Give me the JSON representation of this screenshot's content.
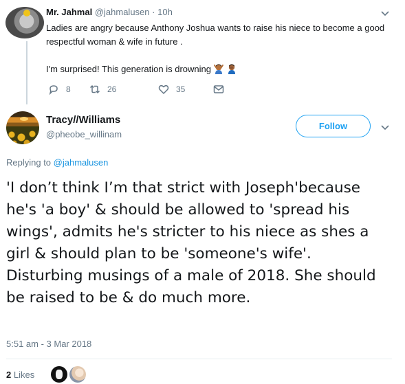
{
  "parent_tweet": {
    "author_name": "Mr. Jahmal",
    "author_handle": "@jahmalusen",
    "age": "10h",
    "text_line1": "Ladies are angry because Anthony Joshua wants to raise his niece to become a good respectful woman & wife in future  .",
    "text_line2": "I'm surprised! This generation is drowning",
    "emojis": [
      "person-gesturing-no-emoji",
      "person-facepalming-emoji"
    ],
    "reply_count": "8",
    "retweet_count": "26",
    "like_count": "35"
  },
  "main_tweet": {
    "author_name": "Tracy//Williams",
    "author_handle": "@pheobe_willinam",
    "follow_label": "Follow",
    "replying_prefix": "Replying to",
    "replying_to": "@jahmalusen",
    "text": "'I don’t think I’m that strict with Joseph'because he's 'a boy' & should be allowed to 'spread his wings', admits he's stricter to his niece as shes a girl & should plan to be 'someone's wife'. Disturbing musings of a male of 2018.  She should be raised to be & do much more.",
    "timestamp": "5:51 am - 3 Mar 2018",
    "likes_count": "2",
    "likes_label": "Likes"
  },
  "colors": {
    "accent": "#1da1f2",
    "link": "#1b95e0",
    "secondary_text": "#657786",
    "primary_text": "#14171a",
    "divider": "#e6ecf0"
  },
  "icons": [
    "reply-icon",
    "retweet-icon",
    "like-icon",
    "direct-message-icon",
    "chevron-down-icon"
  ]
}
